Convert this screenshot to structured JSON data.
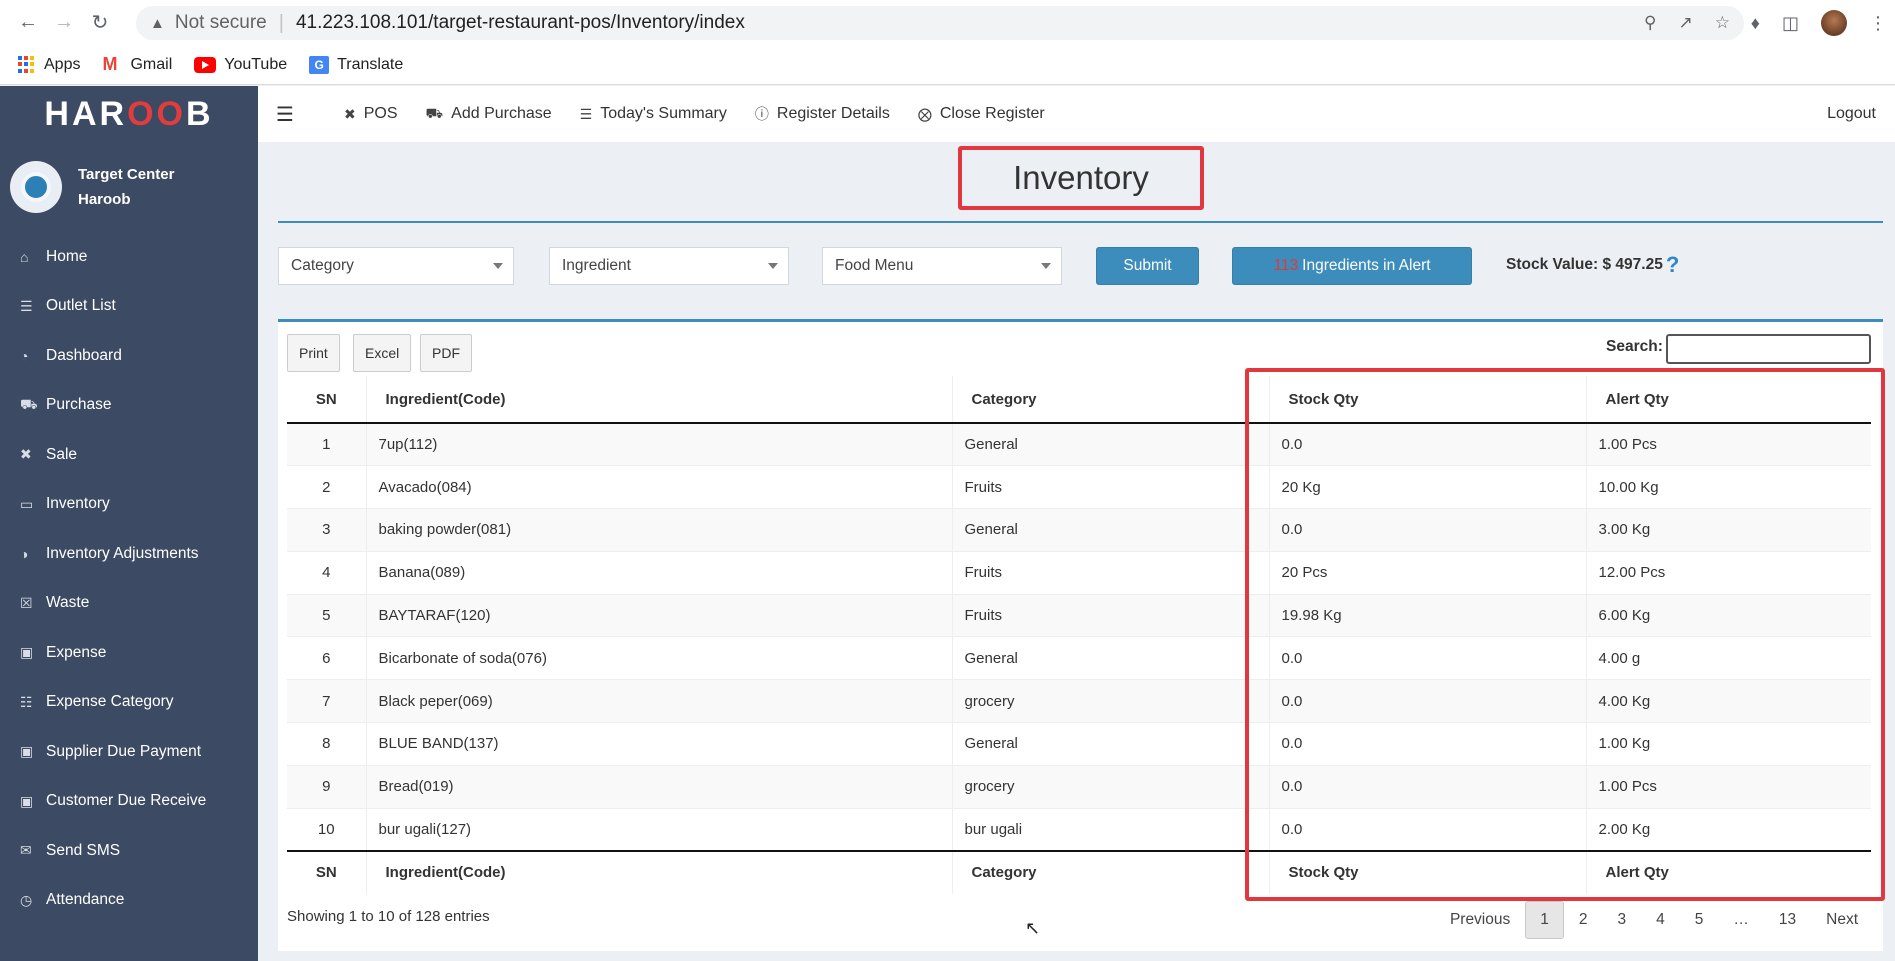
{
  "browser": {
    "security": "Not secure",
    "url": "41.223.108.101/target-restaurant-pos/Inventory/index",
    "bookmarks": [
      {
        "label": "Apps",
        "icon": "apps-grid-icon"
      },
      {
        "label": "Gmail",
        "icon": "gmail-icon"
      },
      {
        "label": "YouTube",
        "icon": "youtube-icon"
      },
      {
        "label": "Translate",
        "icon": "translate-icon"
      }
    ]
  },
  "sidebar": {
    "logo": {
      "pre": "HAR",
      "mid": "OO",
      "post": "B"
    },
    "user": {
      "line1": "Target Center",
      "line2": "Haroob"
    },
    "items": [
      {
        "label": "Home",
        "icon": "home-icon"
      },
      {
        "label": "Outlet List",
        "icon": "list-icon"
      },
      {
        "label": "Dashboard",
        "icon": "dashboard-icon"
      },
      {
        "label": "Purchase",
        "icon": "truck-icon"
      },
      {
        "label": "Sale",
        "icon": "cutlery-icon"
      },
      {
        "label": "Inventory",
        "icon": "inbox-icon"
      },
      {
        "label": "Inventory Adjustments",
        "icon": "adjust-icon"
      },
      {
        "label": "Waste",
        "icon": "trash-icon"
      },
      {
        "label": "Expense",
        "icon": "money-icon"
      },
      {
        "label": "Expense Category",
        "icon": "list-alt-icon"
      },
      {
        "label": "Supplier Due Payment",
        "icon": "money-icon"
      },
      {
        "label": "Customer Due Receive",
        "icon": "money-icon"
      },
      {
        "label": "Send SMS",
        "icon": "envelope-icon"
      },
      {
        "label": "Attendance",
        "icon": "clock-icon"
      }
    ]
  },
  "topbar": {
    "links": [
      {
        "label": "POS",
        "icon": "cutlery-icon"
      },
      {
        "label": "Add Purchase",
        "icon": "truck-icon"
      },
      {
        "label": "Today's Summary",
        "icon": "list-icon"
      },
      {
        "label": "Register Details",
        "icon": "info-circle-icon"
      },
      {
        "label": "Close Register",
        "icon": "times-circle-icon"
      }
    ],
    "logout": "Logout"
  },
  "page": {
    "title": "Inventory",
    "filters": {
      "category": "Category",
      "ingredient": "Ingredient",
      "food_menu": "Food Menu",
      "submit": "Submit",
      "alert_count": "113",
      "alert_label": "Ingredients in Alert",
      "stock_value": "Stock Value: $ 497.25"
    },
    "export_buttons": [
      "Print",
      "Excel",
      "PDF"
    ],
    "search_label": "Search:",
    "search_value": ""
  },
  "table": {
    "columns": [
      "SN",
      "Ingredient(Code)",
      "Category",
      "Stock Qty",
      "Alert Qty"
    ],
    "rows": [
      [
        "1",
        "7up(112)",
        "General",
        "0.0",
        "1.00 Pcs"
      ],
      [
        "2",
        "Avacado(084)",
        "Fruits",
        "20 Kg",
        "10.00 Kg"
      ],
      [
        "3",
        "baking powder(081)",
        "General",
        "0.0",
        "3.00 Kg"
      ],
      [
        "4",
        "Banana(089)",
        "Fruits",
        "20 Pcs",
        "12.00 Pcs"
      ],
      [
        "5",
        "BAYTARAF(120)",
        "Fruits",
        "19.98 Kg",
        "6.00 Kg"
      ],
      [
        "6",
        "Bicarbonate of soda(076)",
        "General",
        "0.0",
        "4.00 g"
      ],
      [
        "7",
        "Black peper(069)",
        "grocery",
        "0.0",
        "4.00 Kg"
      ],
      [
        "8",
        "BLUE BAND(137)",
        "General",
        "0.0",
        "1.00 Kg"
      ],
      [
        "9",
        "Bread(019)",
        "grocery",
        "0.0",
        "1.00 Pcs"
      ],
      [
        "10",
        "bur ugali(127)",
        "bur ugali",
        "0.0",
        "2.00 Kg"
      ]
    ],
    "info": "Showing 1 to 10 of 128 entries",
    "pagination": [
      "Previous",
      "1",
      "2",
      "3",
      "4",
      "5",
      "…",
      "13",
      "Next"
    ],
    "active_page": "1"
  },
  "colors": {
    "accent": "#3c8dbc",
    "sidebar": "#3c4a63",
    "highlight": "#e0383e"
  }
}
